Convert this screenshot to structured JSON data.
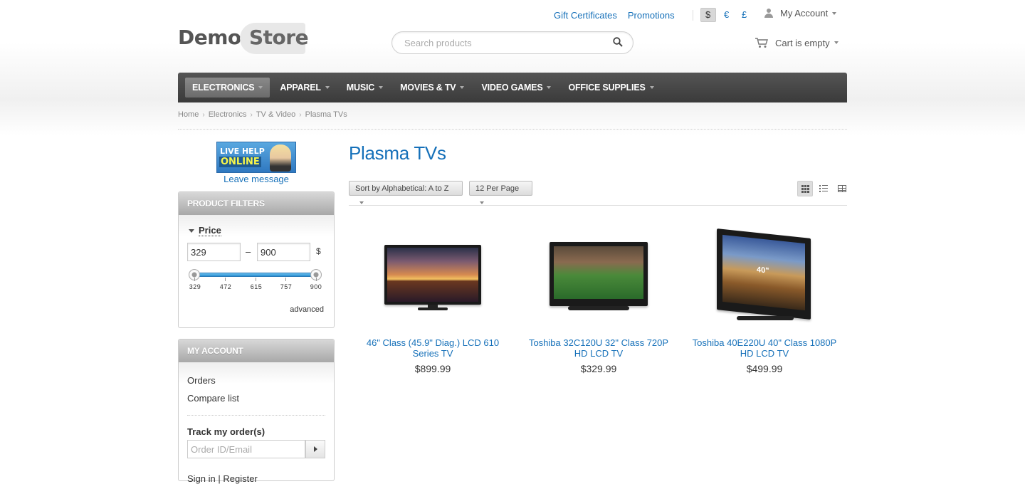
{
  "header": {
    "top_links": [
      "Gift Certificates",
      "Promotions"
    ],
    "currencies": [
      {
        "symbol": "$",
        "active": true
      },
      {
        "symbol": "€",
        "active": false
      },
      {
        "symbol": "£",
        "active": false
      }
    ],
    "account_label": "My Account",
    "logo": {
      "part1": "Demo",
      "part2": "Store"
    },
    "search_placeholder": "Search products",
    "cart_label": "Cart is empty"
  },
  "nav": {
    "items": [
      {
        "label": "ELECTRONICS",
        "active": true
      },
      {
        "label": "APPAREL",
        "active": false
      },
      {
        "label": "MUSIC",
        "active": false
      },
      {
        "label": "MOVIES & TV",
        "active": false
      },
      {
        "label": "VIDEO GAMES",
        "active": false
      },
      {
        "label": "OFFICE SUPPLIES",
        "active": false
      }
    ]
  },
  "breadcrumb": [
    "Home",
    "Electronics",
    "TV & Video",
    "Plasma TVs"
  ],
  "sidebar": {
    "live_help": {
      "line1": "LIVE HELP",
      "line2": "ONLINE"
    },
    "leave_message": "Leave message",
    "filters": {
      "title": "PRODUCT FILTERS",
      "price_label": "Price",
      "from_value": "329",
      "to_value": "900",
      "dash": "–",
      "currency": "$",
      "ticks": [
        "329",
        "472",
        "615",
        "757",
        "900"
      ],
      "advanced_label": "advanced"
    },
    "my_account": {
      "title": "MY ACCOUNT",
      "links": [
        "Orders",
        "Compare list"
      ],
      "track_title": "Track my order(s)",
      "track_placeholder": "Order ID/Email",
      "signin": "Sign in | Register"
    }
  },
  "main": {
    "title": "Plasma TVs",
    "sort_label": "Sort by Alphabetical: A to Z",
    "per_page_label": "12 Per Page",
    "products": [
      {
        "name": "46\" Class (45.9\" Diag.) LCD 610 Series TV",
        "price": "$899.99",
        "image": "tv-sunset"
      },
      {
        "name": "Toshiba 32C120U 32\" Class 720P HD LCD TV",
        "price": "$329.99",
        "image": "tv-football"
      },
      {
        "name": "Toshiba 40E220U 40\" Class 1080P HD LCD TV",
        "price": "$499.99",
        "image": "tv-landscape",
        "badge": "40\""
      }
    ]
  },
  "colors": {
    "link": "#1570b9",
    "nav_bg": "#3a3a3a",
    "slider": "#2a8fd0"
  }
}
